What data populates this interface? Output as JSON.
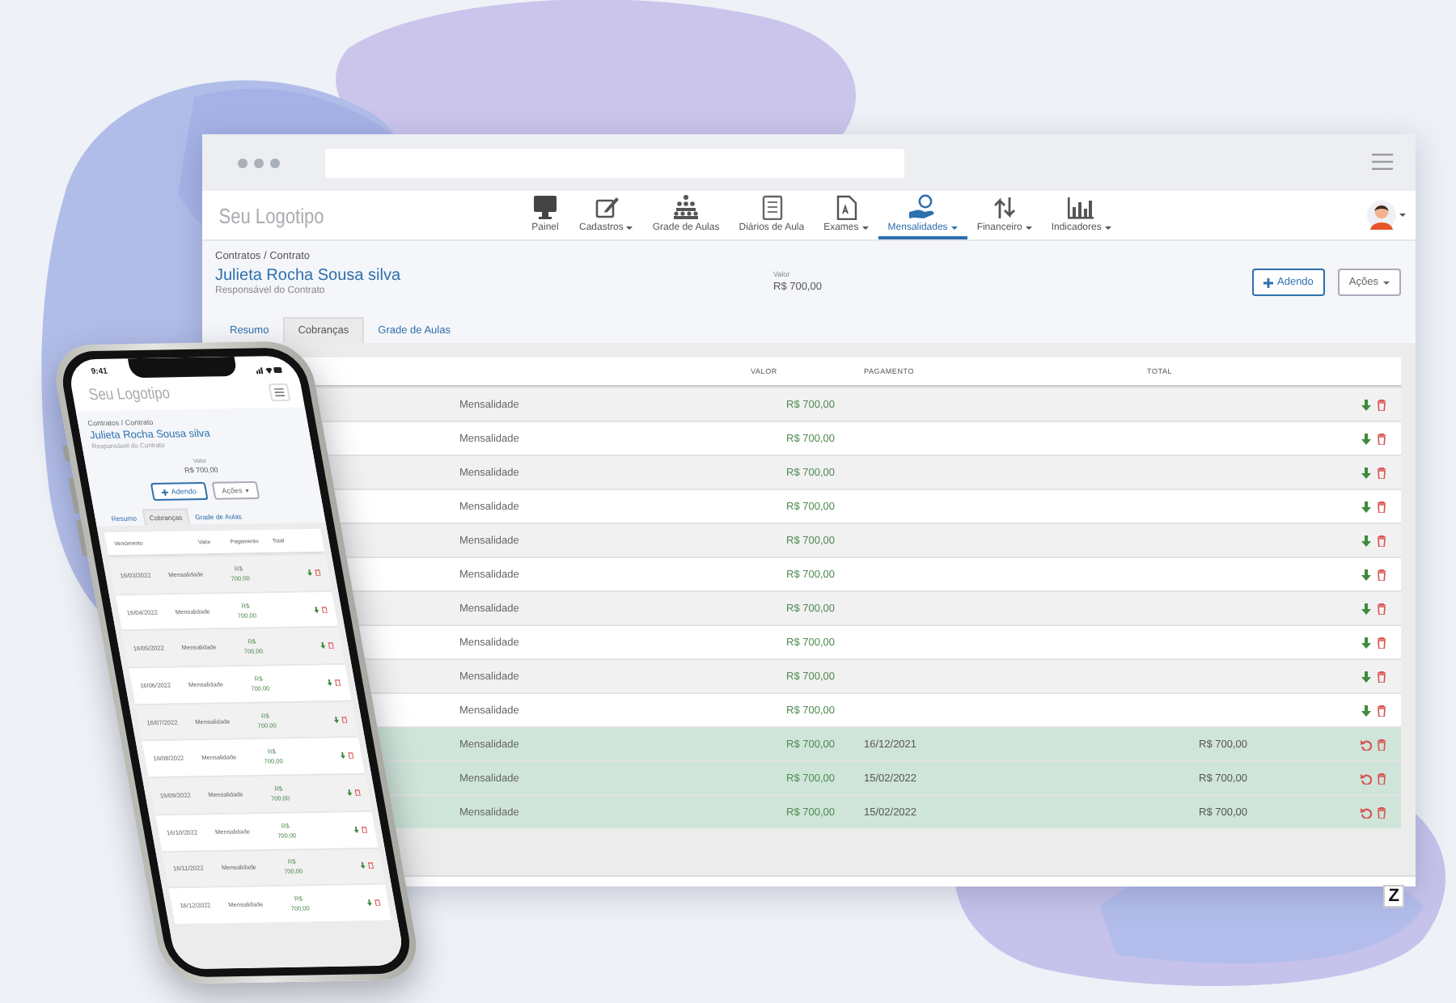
{
  "browser": {
    "logo": "Seu Logotipo",
    "nav": [
      {
        "label": "Painel",
        "selected": false,
        "menu": false
      },
      {
        "label": "Cadastros",
        "selected": false,
        "menu": true
      },
      {
        "label": "Grade de Aulas",
        "selected": false,
        "menu": false
      },
      {
        "label": "Diários de Aula",
        "selected": false,
        "menu": false
      },
      {
        "label": "Exames",
        "selected": false,
        "menu": true
      },
      {
        "label": "Mensalidades",
        "selected": true,
        "menu": true
      },
      {
        "label": "Financeiro",
        "selected": false,
        "menu": true
      },
      {
        "label": "Indicadores",
        "selected": false,
        "menu": true
      }
    ],
    "breadcrumb": "Contratos / Contrato",
    "title": "Julieta Rocha Sousa silva",
    "subtitle": "Responsável do Contrato",
    "value_label": "Valor",
    "value": "R$ 700,00",
    "buttons": [
      {
        "label": "Adendo",
        "kind": "add"
      },
      {
        "label": "Ações",
        "kind": "menu"
      }
    ],
    "tabs": [
      {
        "label": "Resumo",
        "selected": false
      },
      {
        "label": "Cobranças",
        "selected": true
      },
      {
        "label": "Grade de Aulas",
        "selected": false
      }
    ],
    "table": {
      "columns": [
        "VALOR",
        "PAGAMENTO",
        "TOTAL"
      ],
      "rows": [
        {
          "description": "Mensalidade",
          "value": "R$ 700,00",
          "paid": false
        },
        {
          "description": "Mensalidade",
          "value": "R$ 700,00",
          "paid": false
        },
        {
          "description": "Mensalidade",
          "value": "R$ 700,00",
          "paid": false
        },
        {
          "description": "Mensalidade",
          "value": "R$ 700,00",
          "paid": false
        },
        {
          "description": "Mensalidade",
          "value": "R$ 700,00",
          "paid": false
        },
        {
          "description": "Mensalidade",
          "value": "R$ 700,00",
          "paid": false
        },
        {
          "description": "Mensalidade",
          "value": "R$ 700,00",
          "paid": false
        },
        {
          "description": "Mensalidade",
          "value": "R$ 700,00",
          "paid": false
        },
        {
          "description": "Mensalidade",
          "value": "R$ 700,00",
          "paid": false
        },
        {
          "description": "Mensalidade",
          "value": "R$ 700,00",
          "paid": false
        },
        {
          "description": "Mensalidade",
          "value": "R$ 700,00",
          "paid": true,
          "payment": "16/12/2021",
          "total": "R$ 700,00"
        },
        {
          "description": "Mensalidade",
          "value": "R$ 700,00",
          "paid": true,
          "payment": "15/02/2022",
          "total": "R$ 700,00"
        },
        {
          "description": "Mensalidade",
          "value": "R$ 700,00",
          "paid": true,
          "payment": "15/02/2022",
          "total": "R$ 700,00"
        }
      ]
    },
    "footer_logo": "Z"
  },
  "phone": {
    "time": "9:41",
    "logo": "Seu Logotipo",
    "breadcrumb": "Contratos / Contrato",
    "title": "Julieta Rocha Sousa silva",
    "subtitle": "Responsável do Contrato",
    "value_label": "Valor",
    "value": "R$ 700,00",
    "buttons": [
      {
        "label": "Adendo",
        "kind": "add"
      },
      {
        "label": "Ações",
        "kind": "menu"
      }
    ],
    "tabs": [
      {
        "label": "Resumo",
        "selected": false
      },
      {
        "label": "Cobranças",
        "selected": true
      },
      {
        "label": "Grade de Aulas",
        "selected": false
      }
    ],
    "columns": [
      "Vencimento",
      "Valor",
      "Pagamento",
      "Total"
    ],
    "rows": [
      {
        "date": "16/03/2022",
        "description": "Mensalidade",
        "currency": "R$",
        "amount": "700,00"
      },
      {
        "date": "16/04/2022",
        "description": "Mensalidade",
        "currency": "R$",
        "amount": "700,00"
      },
      {
        "date": "16/05/2022",
        "description": "Mensalidade",
        "currency": "R$",
        "amount": "700,00"
      },
      {
        "date": "16/06/2022",
        "description": "Mensalidade",
        "currency": "R$",
        "amount": "700,00"
      },
      {
        "date": "16/07/2022",
        "description": "Mensalidade",
        "currency": "R$",
        "amount": "700,00"
      },
      {
        "date": "16/08/2022",
        "description": "Mensalidade",
        "currency": "R$",
        "amount": "700,00"
      },
      {
        "date": "16/09/2022",
        "description": "Mensalidade",
        "currency": "R$",
        "amount": "700,00"
      },
      {
        "date": "16/10/2022",
        "description": "Mensalidade",
        "currency": "R$",
        "amount": "700,00"
      },
      {
        "date": "16/11/2022",
        "description": "Mensalidade",
        "currency": "R$",
        "amount": "700,00"
      },
      {
        "date": "16/12/2022",
        "description": "Mensalidade",
        "currency": "R$",
        "amount": "700,00"
      }
    ]
  }
}
